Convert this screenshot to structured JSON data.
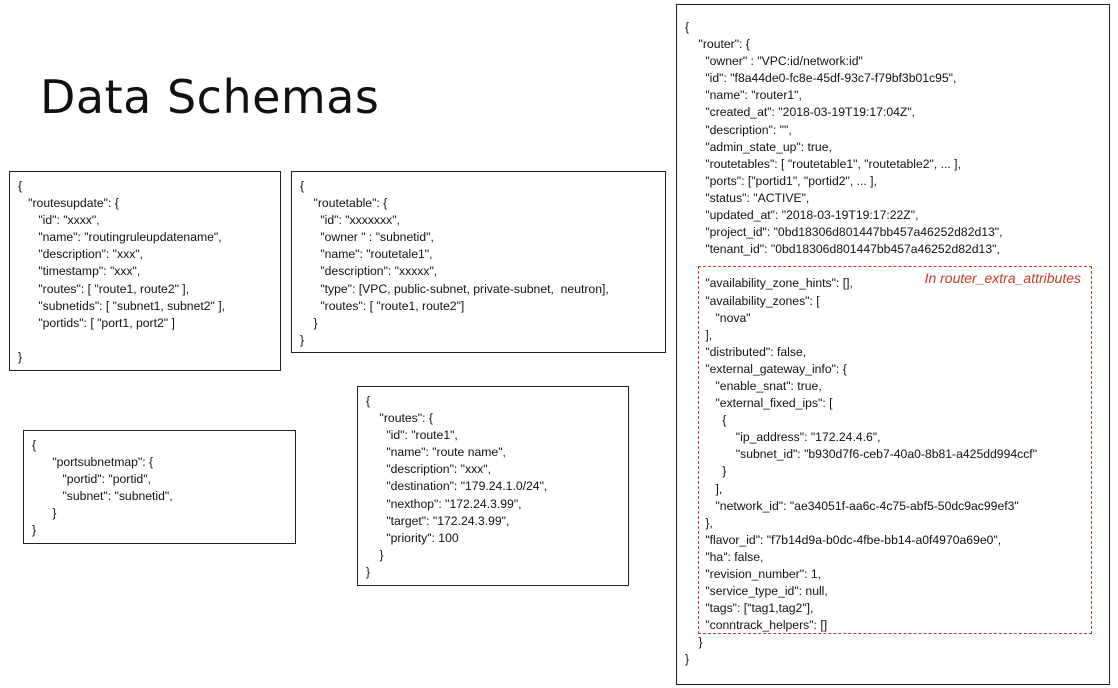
{
  "page": {
    "title": "Data Schemas"
  },
  "routesupdate": {
    "lines": [
      "{",
      "   \"routesupdate\": {",
      "      \"id\": \"xxxx\",",
      "      \"name\": \"routingruleupdatename\",",
      "      \"description\": \"xxx\",",
      "      \"timestamp\": \"xxx\",",
      "      \"routes\": [ \"route1, route2\" ],",
      "      \"subnetids\": [ \"subnet1, subnet2\" ],",
      "      \"portids\": [ \"port1, port2\" ]",
      "",
      "}"
    ]
  },
  "routetable": {
    "lines": [
      "{",
      "    \"routetable\": {",
      "      \"id\": \"xxxxxxx\",",
      "      \"owner \" : \"subnetid\",",
      "      \"name\": \"routetale1\",",
      "      \"description\": \"xxxxx\",",
      "      \"type\": [VPC, public-subnet, private-subnet,  neutron],",
      "      \"routes\": [ \"route1, route2\"]",
      "    }",
      "}"
    ]
  },
  "portsubnetmap": {
    "lines": [
      "{",
      "      \"portsubnetmap\": {",
      "         \"portid\": \"portid\",",
      "         \"subnet\": \"subnetid\",",
      "      }",
      "}"
    ]
  },
  "routes": {
    "lines": [
      "{",
      "    \"routes\": {",
      "      \"id\": \"route1\",",
      "      \"name\": \"route name\",",
      "      \"description\": \"xxx\",",
      "      \"destination\": \"179.24.1.0/24\",",
      "      \"nexthop\": \"172.24.3.99\",",
      "      \"target\": \"172.24.3.99\",",
      "      \"priority\": 100",
      "    }",
      "}"
    ]
  },
  "router": {
    "extra_label": "In router_extra_attributes",
    "lines": [
      "{",
      "    \"router\": {",
      "      \"owner\" : \"VPC:id/network:id\"",
      "      \"id\": \"f8a44de0-fc8e-45df-93c7-f79bf3b01c95\",",
      "      \"name\": \"router1\",",
      "      \"created_at\": \"2018-03-19T19:17:04Z\",",
      "      \"description\": \"\",",
      "      \"admin_state_up\": true,",
      "      \"routetables\": [ \"routetable1\", \"routetable2\", ... ],",
      "      \"ports\": [\"portid1\", \"portid2\", ... ],",
      "      \"status\": \"ACTIVE\",",
      "      \"updated_at\": \"2018-03-19T19:17:22Z\",",
      "      \"project_id\": \"0bd18306d801447bb457a46252d82d13\",",
      "      \"tenant_id\": \"0bd18306d801447bb457a46252d82d13\",",
      "",
      "      \"availability_zone_hints\": [],",
      "      \"availability_zones\": [",
      "         \"nova\"",
      "      ],",
      "      \"distributed\": false,",
      "      \"external_gateway_info\": {",
      "         \"enable_snat\": true,",
      "         \"external_fixed_ips\": [",
      "           {",
      "               \"ip_address\": \"172.24.4.6\",",
      "               \"subnet_id\": \"b930d7f6-ceb7-40a0-8b81-a425dd994ccf\"",
      "           }",
      "         ],",
      "         \"network_id\": \"ae34051f-aa6c-4c75-abf5-50dc9ac99ef3\"",
      "      },",
      "      \"flavor_id\": \"f7b14d9a-b0dc-4fbe-bb14-a0f4970a69e0\",",
      "      \"ha\": false,",
      "      \"revision_number\": 1,",
      "      \"service_type_id\": null,",
      "      \"tags\": [\"tag1,tag2\"],",
      "      \"conntrack_helpers\": []",
      "    }",
      "}"
    ]
  }
}
